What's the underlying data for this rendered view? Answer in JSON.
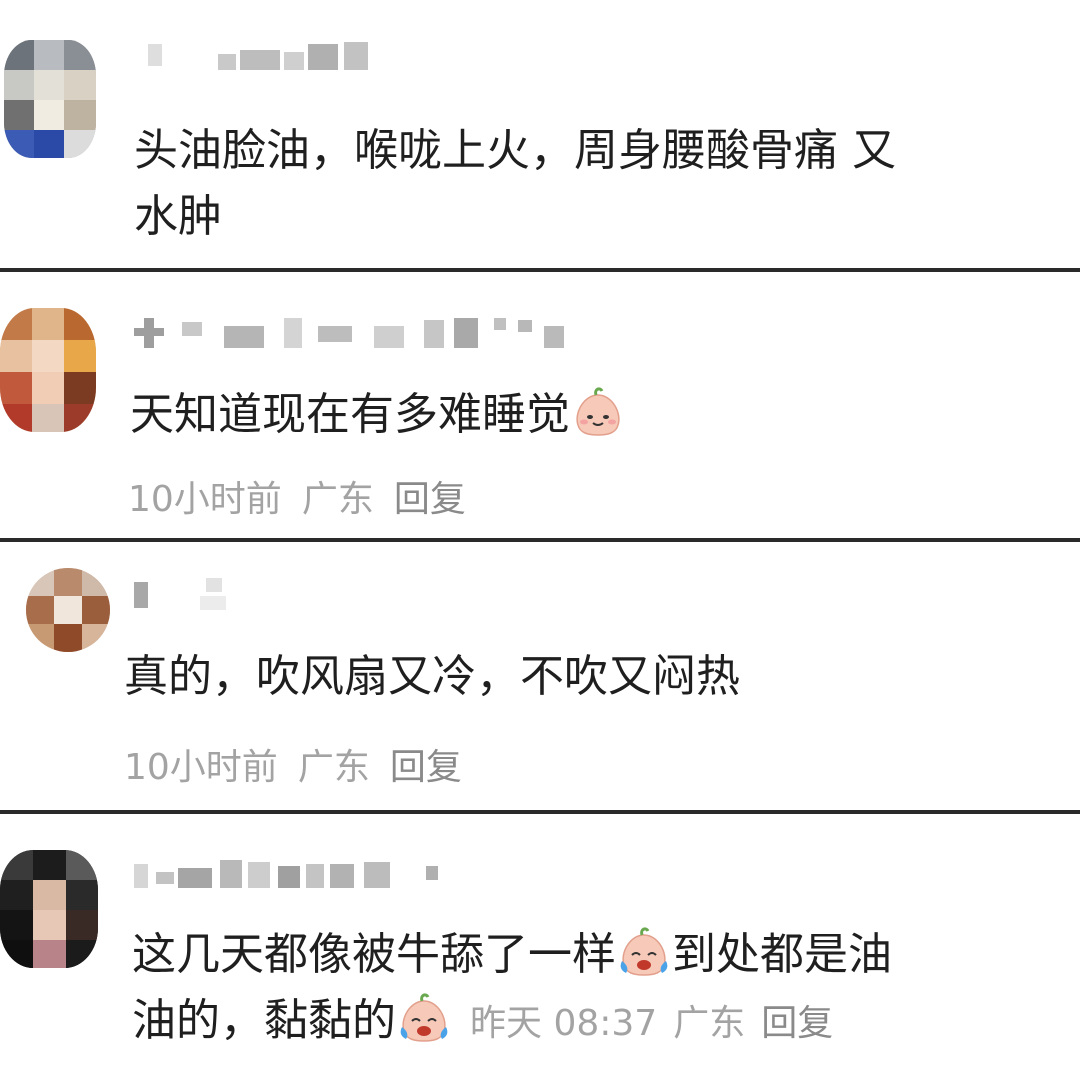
{
  "comments": [
    {
      "text_line1": "头油脸油，喉咙上火，周身腰酸骨痛 又",
      "text_line2": "水肿"
    },
    {
      "text": "天知道现在有多难睡觉",
      "emoji": "smiling-dumpling-emoji",
      "time": "10小时前",
      "location": "广东",
      "reply": "回复"
    },
    {
      "text": "真的，吹风扇又冷，不吹又闷热",
      "time": "10小时前",
      "location": "广东",
      "reply": "回复"
    },
    {
      "text_line1a": "这几天都像被牛舔了一样",
      "emoji1": "crying-dumpling-emoji",
      "text_line1b": "到处都是油",
      "text_line2": "油的，黏黏的",
      "emoji2": "crying-dumpling-emoji",
      "time": "昨天 08:37",
      "location": "广东",
      "reply": "回复"
    }
  ],
  "colors": {
    "divider": "#2a2a2a",
    "meta": "#a3a3a3",
    "text": "#1f1f1f"
  }
}
